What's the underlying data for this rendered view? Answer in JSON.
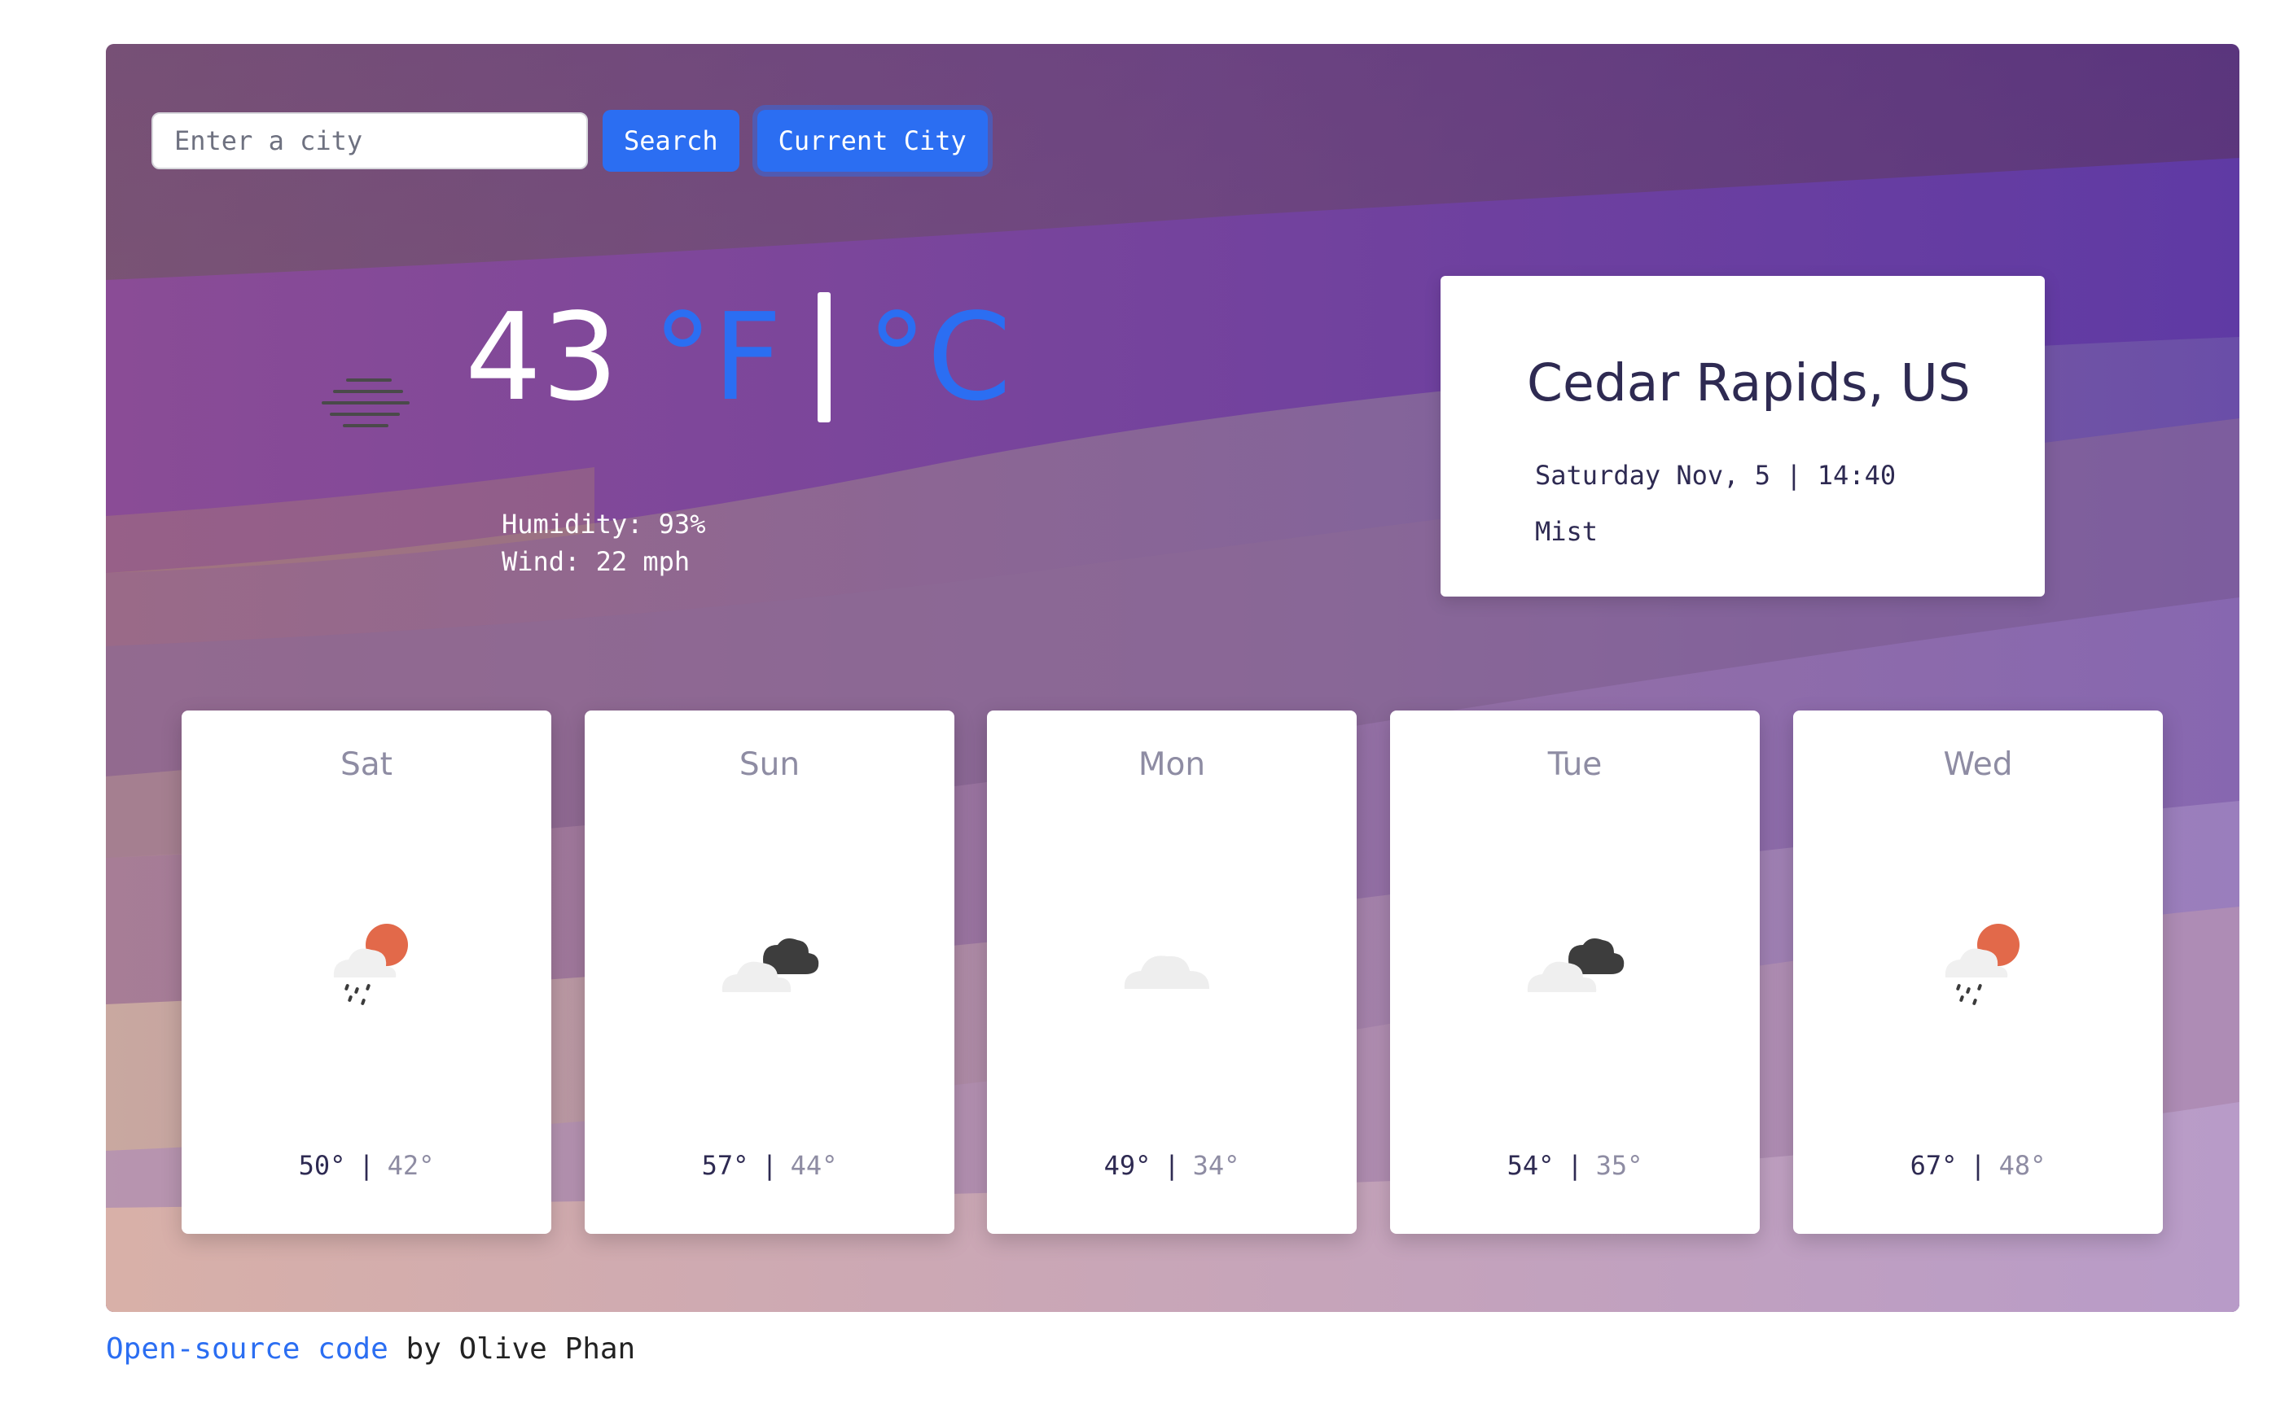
{
  "search": {
    "placeholder": "Enter a city",
    "search_label": "Search",
    "current_city_label": "Current City"
  },
  "current": {
    "temperature": "43",
    "unit_f": "°F",
    "unit_c": "°C",
    "humidity": "Humidity: 93%",
    "wind": "Wind: 22 mph",
    "icon": "mist-icon"
  },
  "location": {
    "city": "Cedar Rapids, US",
    "datetime": "Saturday Nov, 5 | 14:40",
    "condition": "Mist"
  },
  "forecast": [
    {
      "day": "Sat",
      "high": "50°",
      "low": "42°",
      "icon": "sun-cloud-rain-icon"
    },
    {
      "day": "Sun",
      "high": "57°",
      "low": "44°",
      "icon": "dark-clouds-icon"
    },
    {
      "day": "Mon",
      "high": "49°",
      "low": "34°",
      "icon": "cloud-icon"
    },
    {
      "day": "Tue",
      "high": "54°",
      "low": "35°",
      "icon": "dark-clouds-icon"
    },
    {
      "day": "Wed",
      "high": "67°",
      "low": "48°",
      "icon": "sun-cloud-rain-icon"
    }
  ],
  "footer": {
    "link_text": "Open-source code",
    "credit": " by Olive Phan"
  },
  "colors": {
    "accent": "#2b6ef2",
    "heading": "#2e2a52",
    "muted": "#8e8ca3"
  }
}
